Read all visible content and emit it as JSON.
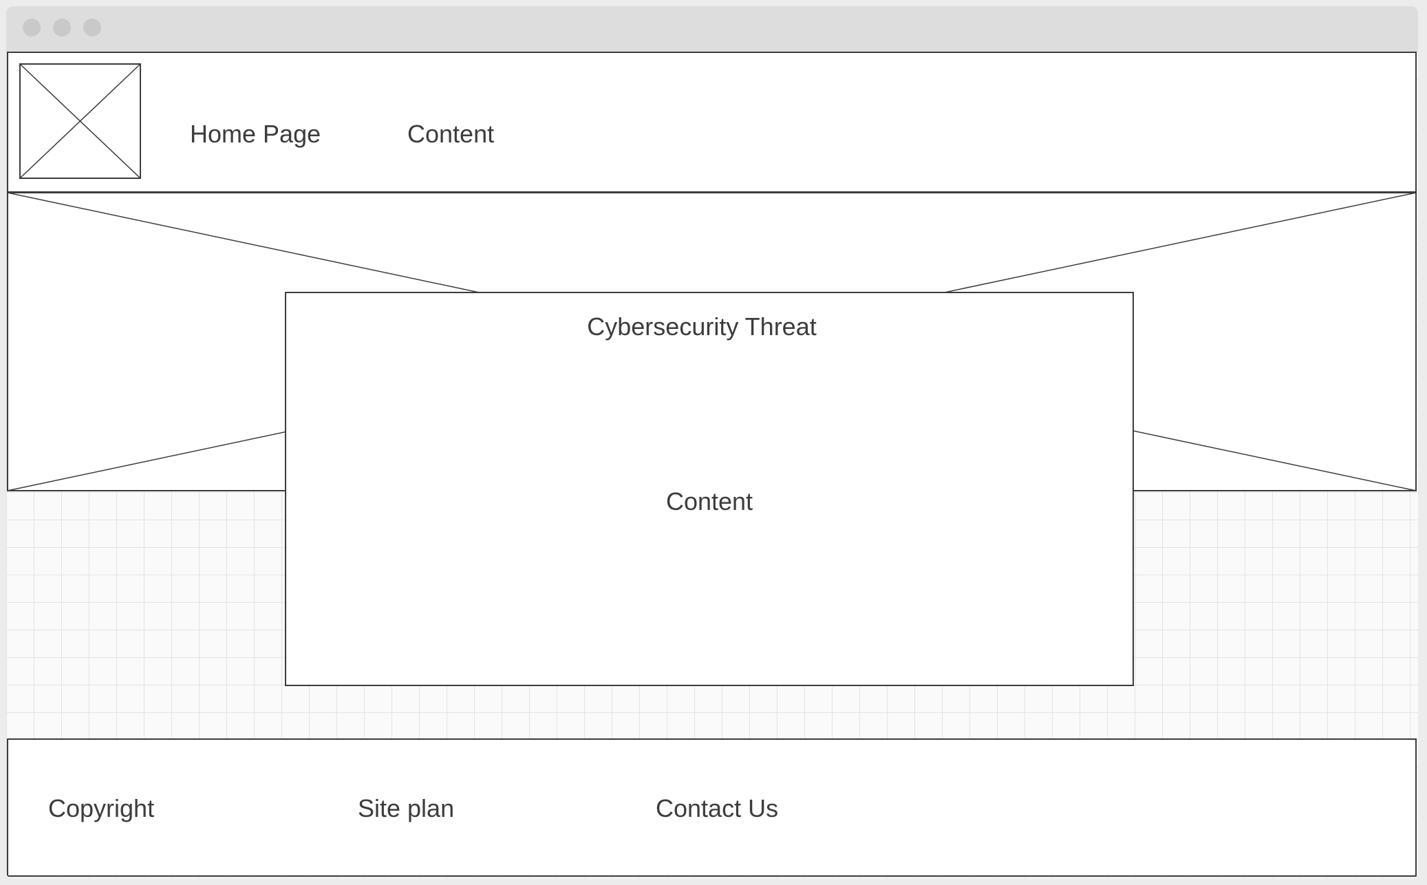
{
  "header": {
    "nav": [
      "Home Page",
      "Content"
    ]
  },
  "dialog": {
    "title": "Cybersecurity Threat",
    "body": "Content"
  },
  "footer": {
    "links": [
      "Copyright",
      "Site plan",
      "Contact Us"
    ]
  },
  "colors": {
    "titlebar": "#dddddd",
    "window_dots": "#c9c9c9",
    "outline": "#3b3b3b",
    "text": "#3c3c3c",
    "grid": "#e3e3e3"
  }
}
